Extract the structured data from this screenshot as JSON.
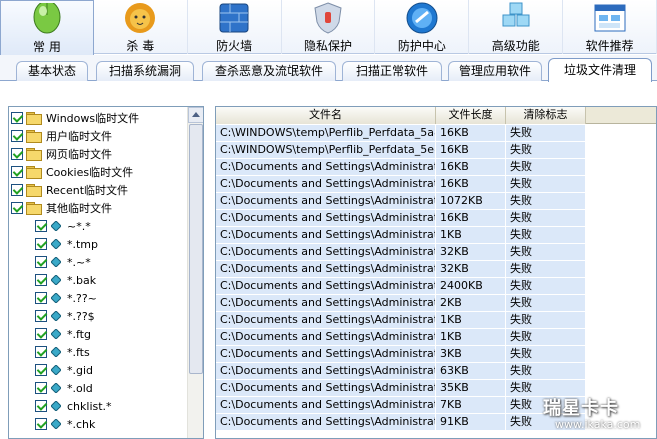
{
  "toolbar": {
    "items": [
      {
        "label": "常 用",
        "icon": "mouse-icon",
        "active": true
      },
      {
        "label": "杀 毒",
        "icon": "lion-icon"
      },
      {
        "label": "防火墙",
        "icon": "firewall-icon"
      },
      {
        "label": "隐私保护",
        "icon": "privacy-shield-icon"
      },
      {
        "label": "防护中心",
        "icon": "protection-center-icon"
      },
      {
        "label": "高级功能",
        "icon": "advanced-cubes-icon"
      },
      {
        "label": "软件推荐",
        "icon": "software-window-icon"
      }
    ]
  },
  "tabs": [
    {
      "label": "基本状态"
    },
    {
      "label": "扫描系统漏洞"
    },
    {
      "label": "查杀恶意及流氓软件"
    },
    {
      "label": "扫描正常软件"
    },
    {
      "label": "管理应用软件"
    },
    {
      "label": "垃圾文件清理",
      "active": true
    }
  ],
  "tree": {
    "folders": [
      {
        "label": "Windows临时文件",
        "checked": true
      },
      {
        "label": "用户临时文件",
        "checked": true
      },
      {
        "label": "网页临时文件",
        "checked": true
      },
      {
        "label": "Cookies临时文件",
        "checked": true
      },
      {
        "label": "Recent临时文件",
        "checked": true
      },
      {
        "label": "其他临时文件",
        "checked": true
      }
    ],
    "patterns": [
      {
        "label": "~*.*",
        "checked": true
      },
      {
        "label": "*.tmp",
        "checked": true
      },
      {
        "label": "*.~*",
        "checked": true
      },
      {
        "label": "*.bak",
        "checked": true
      },
      {
        "label": "*.??~",
        "checked": true
      },
      {
        "label": "*.??$",
        "checked": true
      },
      {
        "label": "*.ftg",
        "checked": true
      },
      {
        "label": "*.fts",
        "checked": true
      },
      {
        "label": "*.gid",
        "checked": true
      },
      {
        "label": "*.old",
        "checked": true
      },
      {
        "label": "chklist.*",
        "checked": true
      },
      {
        "label": "*.chk",
        "checked": true
      }
    ]
  },
  "table": {
    "columns": [
      "文件名",
      "文件长度",
      "清除标志"
    ],
    "rows": [
      {
        "name": "C:\\WINDOWS\\temp\\Perflib_Perfdata_5a8...",
        "size": "16KB",
        "status": "失败"
      },
      {
        "name": "C:\\WINDOWS\\temp\\Perflib_Perfdata_5e8...",
        "size": "16KB",
        "status": "失败"
      },
      {
        "name": "C:\\Documents and Settings\\Administrator\\...",
        "size": "16KB",
        "status": "失败"
      },
      {
        "name": "C:\\Documents and Settings\\Administrator\\...",
        "size": "16KB",
        "status": "失败"
      },
      {
        "name": "C:\\Documents and Settings\\Administrator\\...",
        "size": "1072KB",
        "status": "失败"
      },
      {
        "name": "C:\\Documents and Settings\\Administrator\\...",
        "size": "16KB",
        "status": "失败"
      },
      {
        "name": "C:\\Documents and Settings\\Administrator\\...",
        "size": "1KB",
        "status": "失败"
      },
      {
        "name": "C:\\Documents and Settings\\Administrator\\...",
        "size": "32KB",
        "status": "失败"
      },
      {
        "name": "C:\\Documents and Settings\\Administrator\\...",
        "size": "32KB",
        "status": "失败"
      },
      {
        "name": "C:\\Documents and Settings\\Administrator\\...",
        "size": "2400KB",
        "status": "失败"
      },
      {
        "name": "C:\\Documents and Settings\\Administrator\\...",
        "size": "2KB",
        "status": "失败"
      },
      {
        "name": "C:\\Documents and Settings\\Administrator\\...",
        "size": "1KB",
        "status": "失败"
      },
      {
        "name": "C:\\Documents and Settings\\Administrator\\...",
        "size": "1KB",
        "status": "失败"
      },
      {
        "name": "C:\\Documents and Settings\\Administrator\\...",
        "size": "3KB",
        "status": "失败"
      },
      {
        "name": "C:\\Documents and Settings\\Administrator\\...",
        "size": "63KB",
        "status": "失败"
      },
      {
        "name": "C:\\Documents and Settings\\Administrator\\...",
        "size": "35KB",
        "status": "失败"
      },
      {
        "name": "C:\\Documents and Settings\\Administrator\\...",
        "size": "7KB",
        "status": "失败"
      },
      {
        "name": "C:\\Documents and Settings\\Administrator\\...",
        "size": "91KB",
        "status": "失败"
      }
    ]
  },
  "watermark": {
    "logo": "瑞星卡卡",
    "url": "www.ikaka.com"
  },
  "colors": {
    "row_bg": "#dbe8f9",
    "border": "#7f9db9",
    "check": "#21a121"
  }
}
